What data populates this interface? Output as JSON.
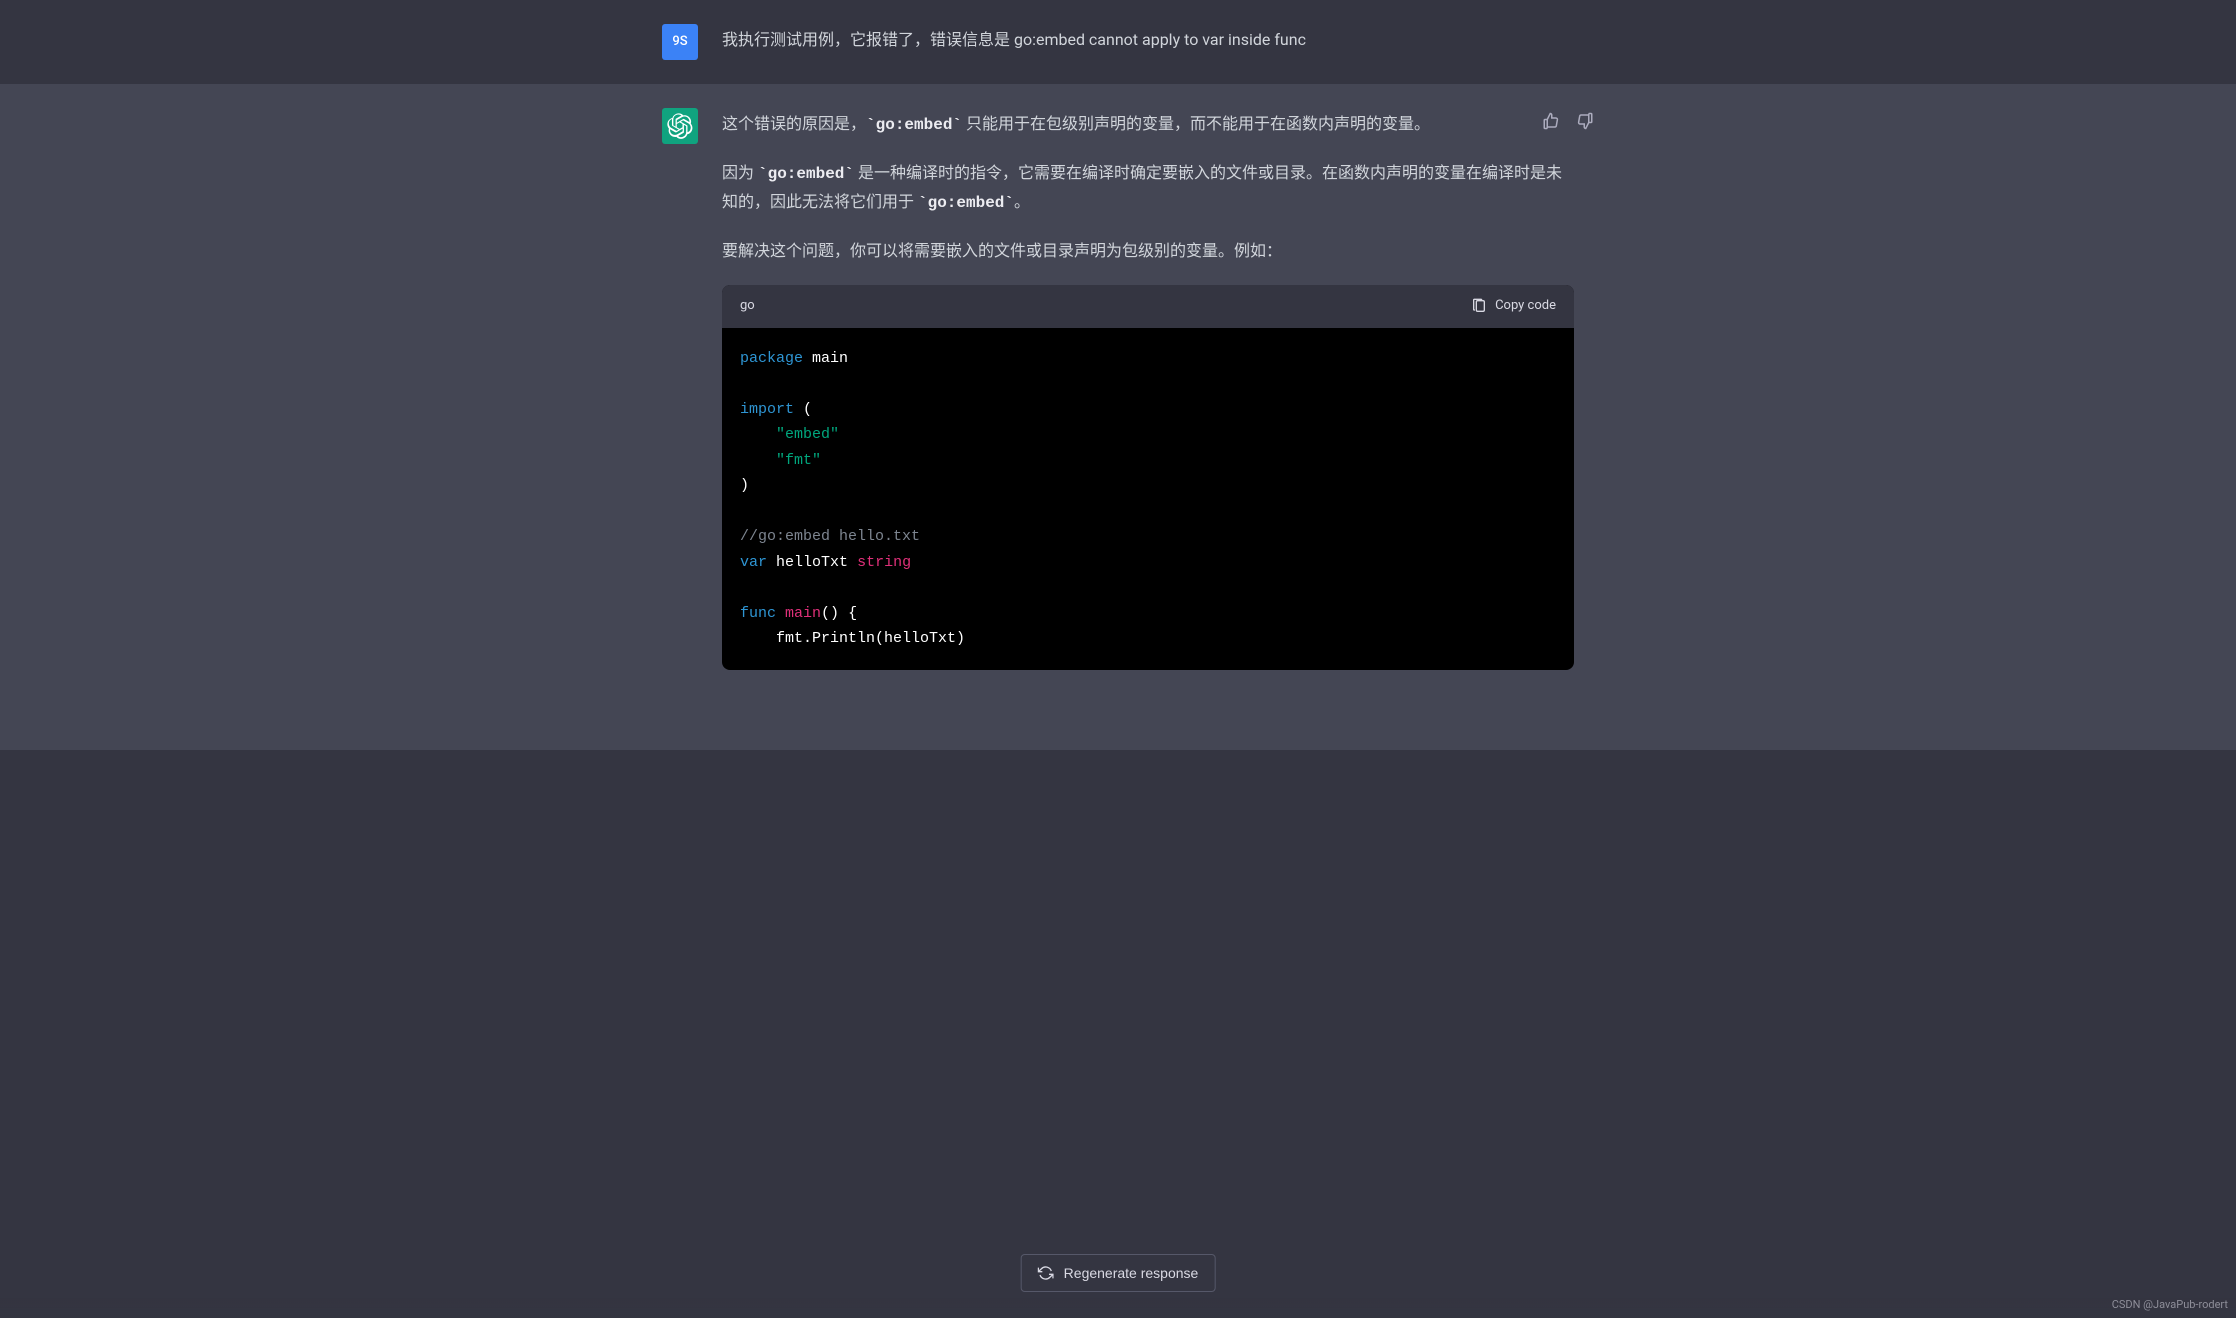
{
  "user": {
    "avatar_text": "9S",
    "message": "我执行测试用例，它报错了，错误信息是   go:embed cannot apply to var inside func"
  },
  "assistant": {
    "p1_prefix": "这个错误的原因是，",
    "p1_code": "`go:embed`",
    "p1_suffix": " 只能用于在包级别声明的变量，而不能用于在函数内声明的变量。",
    "p2_prefix": "因为 ",
    "p2_code1": "`go:embed`",
    "p2_mid": " 是一种编译时的指令，它需要在编译时确定要嵌入的文件或目录。在函数内声明的变量在编译时是未知的，因此无法将它们用于 ",
    "p2_code2": "`go:embed`",
    "p2_suffix": "。",
    "p3": "要解决这个问题，你可以将需要嵌入的文件或目录声明为包级别的变量。例如："
  },
  "code": {
    "language": "go",
    "copy_label": "Copy code",
    "tokens": {
      "package": "package",
      "main": "main",
      "import": "import",
      "open_paren": "(",
      "close_paren": ")",
      "str_embed": "\"embed\"",
      "str_fmt": "\"fmt\"",
      "comment_embed": "//go:embed hello.txt",
      "var_kw": "var",
      "var_name": "helloTxt",
      "var_type": "string",
      "func_kw": "func",
      "func_name": "main",
      "empty_parens": "()",
      "open_brace": "{",
      "fmt_println": "fmt.Println(helloTxt)"
    }
  },
  "regenerate": {
    "label": "Regenerate response"
  },
  "watermark": {
    "text": "CSDN @JavaPub-rodert"
  }
}
